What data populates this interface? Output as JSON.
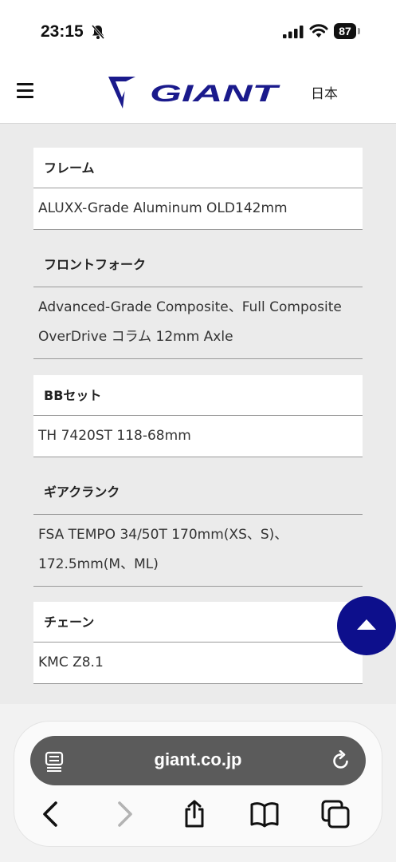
{
  "status_bar": {
    "time": "23:15",
    "battery_level": "87",
    "icons": [
      "bell-slash-icon",
      "cellular-signal-icon",
      "wifi-icon",
      "battery-icon"
    ]
  },
  "header": {
    "logo_text": "GIANT",
    "language": "日本",
    "brand_color": "#1a1a8c"
  },
  "specs": [
    {
      "label": "フレーム",
      "value": "ALUXX-Grade Aluminum OLD142mm"
    },
    {
      "label": "フロントフォーク",
      "value": "Advanced-Grade Composite、Full Composite\nOverDrive コラム 12mm Axle"
    },
    {
      "label": "BBセット",
      "value": "TH 7420ST 118-68mm"
    },
    {
      "label": "ギアクランク",
      "value": "FSA TEMPO 34/50T 170mm(XS、S)、\n172.5mm(M、ML)"
    },
    {
      "label": "チェーン",
      "value": "KMC Z8.1"
    }
  ],
  "scroll_top": {
    "icon": "arrow-up-icon",
    "color": "#0d0f8c"
  },
  "browser": {
    "url": "giant.co.jp",
    "icons": [
      "reader-icon",
      "reload-icon",
      "back-icon",
      "forward-icon",
      "share-icon",
      "bookmarks-icon",
      "tabs-icon"
    ]
  }
}
